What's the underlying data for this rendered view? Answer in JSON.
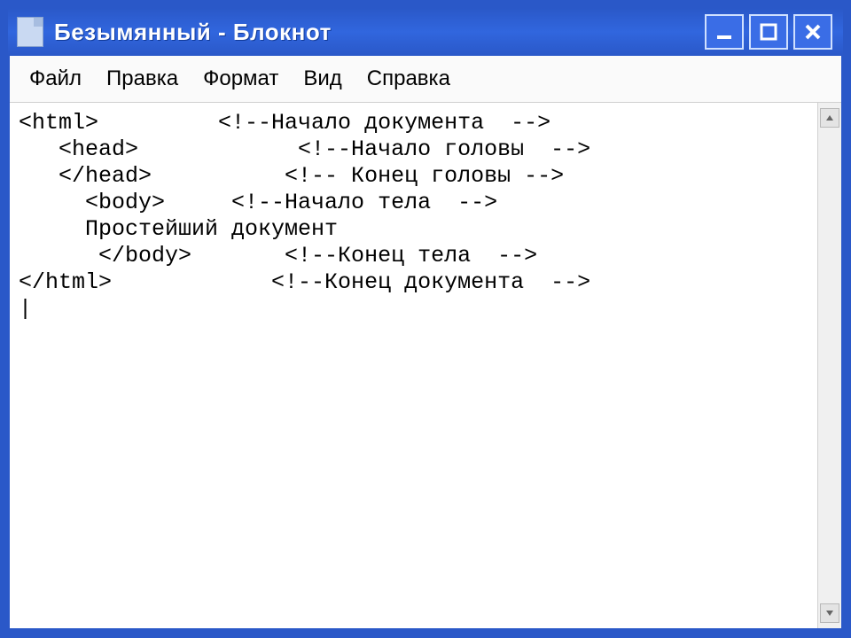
{
  "window": {
    "title": "Безымянный - Блокнот"
  },
  "menubar": {
    "items": [
      "Файл",
      "Правка",
      "Формат",
      "Вид",
      "Справка"
    ]
  },
  "editor": {
    "content": "<html>         <!--Начало документа  -->\n   <head>            <!--Начало головы  -->\n   </head>          <!-- Конец головы -->\n     <body>     <!--Начало тела  -->\n     Простейший документ\n      </body>       <!--Конец тела  -->\n</html>            <!--Конец документа  -->\n|"
  },
  "controls": {
    "minimize": "minimize",
    "maximize": "maximize",
    "close": "close"
  }
}
